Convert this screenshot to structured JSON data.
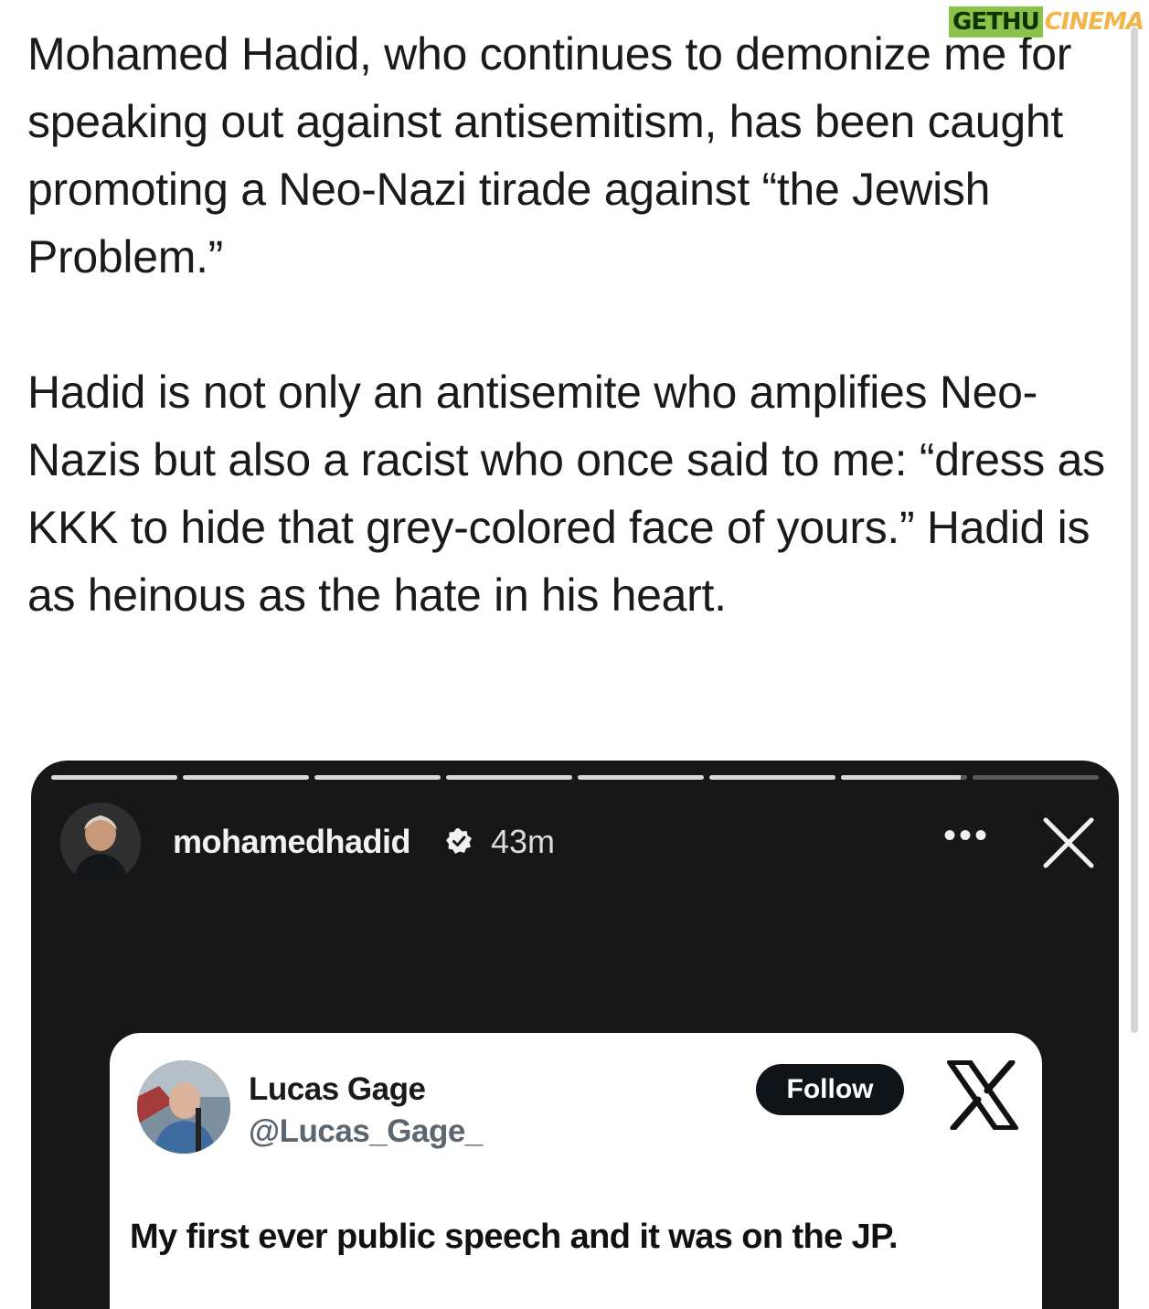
{
  "post": {
    "paragraph1": "Mohamed Hadid, who continues to demonize me for speaking out against antisemitism, has been caught promoting a Neo-Nazi tirade against “the Jewish Problem.”",
    "paragraph2": "Hadid is not only an antisemite who amplifies Neo-Nazis but also a racist who once said to me: “dress as KKK to hide that grey-colored face of yours.” Hadid is as heinous as the hate in his heart."
  },
  "watermark": {
    "part1": "GETHU",
    "part2": "CINEMA"
  },
  "story": {
    "username": "mohamedhadid",
    "time": "43m",
    "more_label": "•••",
    "progress": [
      1,
      1,
      1,
      1,
      1,
      1,
      0.95,
      0
    ],
    "icons": {
      "verified": "verified-badge-icon",
      "close": "close-icon",
      "more": "more-options-icon"
    }
  },
  "tweet": {
    "display_name": "Lucas Gage",
    "handle": "@Lucas_Gage_",
    "follow_label": "Follow",
    "text": "My first ever public speech and it was on the JP.",
    "icons": {
      "logo": "x-logo-icon"
    }
  },
  "colors": {
    "story_bg": "#171717",
    "follow_bg": "#0f1419",
    "watermark_green": "#8bc34a",
    "watermark_orange": "#f3b44a"
  }
}
